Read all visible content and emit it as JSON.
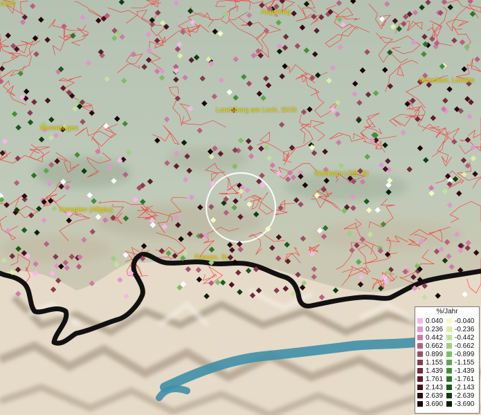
{
  "map": {
    "places": [
      {
        "name": "stadt"
      },
      {
        "name": "Augsburg"
      },
      {
        "name": "München, Landes"
      },
      {
        "name": "Landsberg am Lech, SKSt"
      },
      {
        "name": "Memmingen"
      },
      {
        "name": "Weilheim i.OB, St"
      },
      {
        "name": "Kempten (Allgäu)"
      },
      {
        "name": "Füssen, St"
      }
    ],
    "colors": {
      "water": "#3f8fa8",
      "boundary": "#ff2a2a",
      "border": "#111111",
      "focus_circle": "#ffffff"
    }
  },
  "legend": {
    "title": "%/Jahr",
    "positive": [
      {
        "label": "0.040",
        "color": "#f6b7ea"
      },
      {
        "label": "0.236",
        "color": "#e197cd"
      },
      {
        "label": "0.442",
        "color": "#d17aa9"
      },
      {
        "label": "0.662",
        "color": "#b8607f"
      },
      {
        "label": "0.899",
        "color": "#a14c67"
      },
      {
        "label": "1.155",
        "color": "#8a3a50"
      },
      {
        "label": "1.439",
        "color": "#742a3c"
      },
      {
        "label": "1.761",
        "color": "#5e1c2c"
      },
      {
        "label": "2.143",
        "color": "#48101e"
      },
      {
        "label": "2.639",
        "color": "#320812"
      },
      {
        "label": "3.690",
        "color": "#1c0206"
      }
    ],
    "negative": [
      {
        "label": "-0.040",
        "color": "#f6f9c2"
      },
      {
        "label": "-0.236",
        "color": "#dcee a8"
      },
      {
        "label": "-0.442",
        "color": "#c2e29b"
      },
      {
        "label": "-0.662",
        "color": "#9fd07f"
      },
      {
        "label": "-0.899",
        "color": "#7fbe65"
      },
      {
        "label": "-1.155",
        "color": "#5fa64d"
      },
      {
        "label": "-1.439",
        "color": "#438e39"
      },
      {
        "label": "-1.761",
        "color": "#2c7428"
      },
      {
        "label": "-2.143",
        "color": "#1a5a1a"
      },
      {
        "label": "-2.639",
        "color": "#0e3e0f"
      },
      {
        "label": "-3.690",
        "color": "#052205"
      }
    ]
  }
}
